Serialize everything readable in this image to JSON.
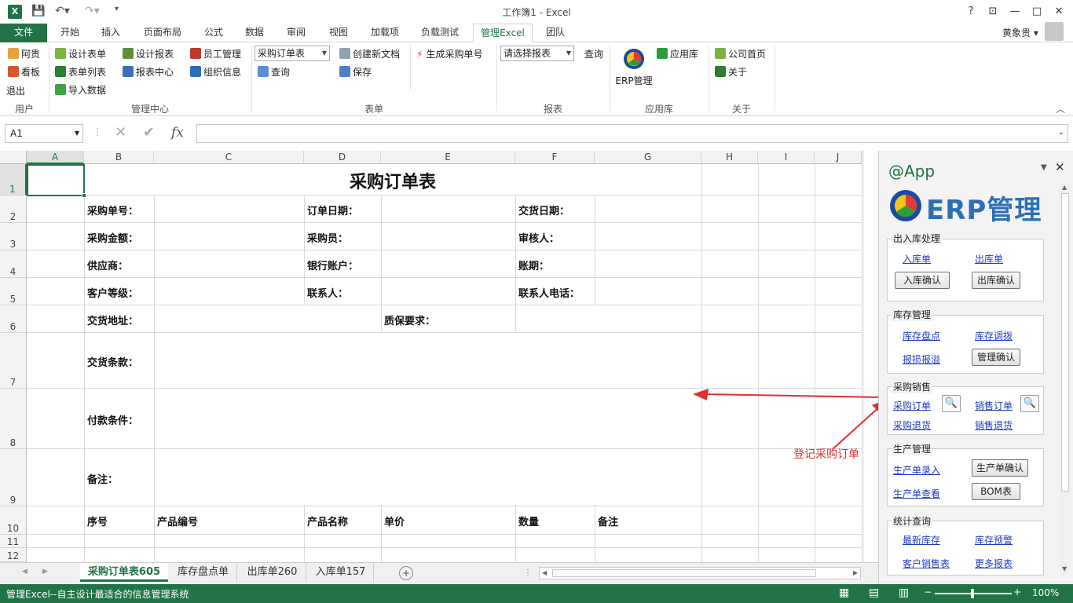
{
  "window": {
    "title": "工作簿1 - Excel",
    "help": "?",
    "minimize": "—",
    "restore": "□",
    "close": "✕"
  },
  "tabs": [
    "开始",
    "插入",
    "页面布局",
    "公式",
    "数据",
    "审阅",
    "视图",
    "加载项",
    "负载测试",
    "管理Excel",
    "团队"
  ],
  "file_tab": "文件",
  "user": "黄象贵",
  "ribbon": {
    "user_group": {
      "items": [
        "阿贵",
        "看板",
        "退出"
      ],
      "label": "用户"
    },
    "manage_group": {
      "items": [
        "设计表单",
        "表单列表",
        "导入数据",
        "设计报表",
        "报表中心",
        "员工管理",
        "组织信息"
      ],
      "label": "管理中心"
    },
    "form_group": {
      "combo": "采购订单表",
      "query": "查询",
      "new_doc": "创建新文档",
      "save": "保存",
      "gen": "生成采购单号",
      "label": "表单"
    },
    "report_group": {
      "combo": "请选择报表",
      "query": "查询",
      "label": "报表"
    },
    "app_group": {
      "erp": "ERP管理",
      "app": "应用库",
      "label": "应用库"
    },
    "about_group": {
      "home": "公司首页",
      "about": "关于",
      "label": "关于"
    }
  },
  "formula": {
    "namebox": "A1",
    "fx": "fx"
  },
  "sheet": {
    "columns": [
      "A",
      "B",
      "C",
      "D",
      "E",
      "F",
      "G",
      "H",
      "I",
      "J"
    ],
    "rows": [
      "1",
      "2",
      "3",
      "4",
      "5",
      "6",
      "7",
      "8",
      "9",
      "10",
      "11",
      "12"
    ],
    "title": "采购订单表",
    "cells": {
      "r2b": "采购单号：",
      "r2d": "订单日期：",
      "r2f": "交货日期：",
      "r3b": "采购金额：",
      "r3d": "采购员：",
      "r3f": "审核人：",
      "r4b": "供应商：",
      "r4d": "银行账户：",
      "r4f": "账期：",
      "r5b": "客户等级：",
      "r5d": "联系人：",
      "r5f": "联系人电话：",
      "r6b": "交货地址：",
      "r6e": "质保要求：",
      "r7b": "交货条款：",
      "r8b": "付款条件：",
      "r9b": "备注：",
      "r10b": "序号",
      "r10c": "产品编号",
      "r10d": "产品名称",
      "r10e": "单价",
      "r10f": "数量",
      "r10g": "备注"
    }
  },
  "sheet_tabs": [
    "采购订单表605",
    "库存盘点单",
    "出库单260",
    "入库单157"
  ],
  "status": {
    "text": "管理Excel--自主设计最适合的信息管理系统",
    "zoom": "100%"
  },
  "annotation": "登记采购订单",
  "pane": {
    "title": "@App",
    "logo_text": "ERP管理",
    "sections": {
      "io": {
        "title": "出入库处理",
        "links": [
          "入库单",
          "出库单"
        ],
        "buttons": [
          "入库确认",
          "出库确认"
        ]
      },
      "inv": {
        "title": "库存管理",
        "links": [
          "库存盘点",
          "库存调拨",
          "报损报溢"
        ],
        "button": "管理确认"
      },
      "sales": {
        "title": "采购销售",
        "links": [
          "采购订单",
          "销售订单",
          "采购退货",
          "销售退货"
        ]
      },
      "prod": {
        "title": "生产管理",
        "links": [
          "生产单录入",
          "生产单查看"
        ],
        "buttons": [
          "生产单确认",
          "BOM表"
        ]
      },
      "stat": {
        "title": "统计查询",
        "links": [
          "最新库存",
          "库存预警",
          "客户销售表",
          "更多报表"
        ]
      }
    }
  },
  "colors": {
    "accent": "#217346",
    "link": "#1f3bbf",
    "arrow": "#e03030"
  }
}
